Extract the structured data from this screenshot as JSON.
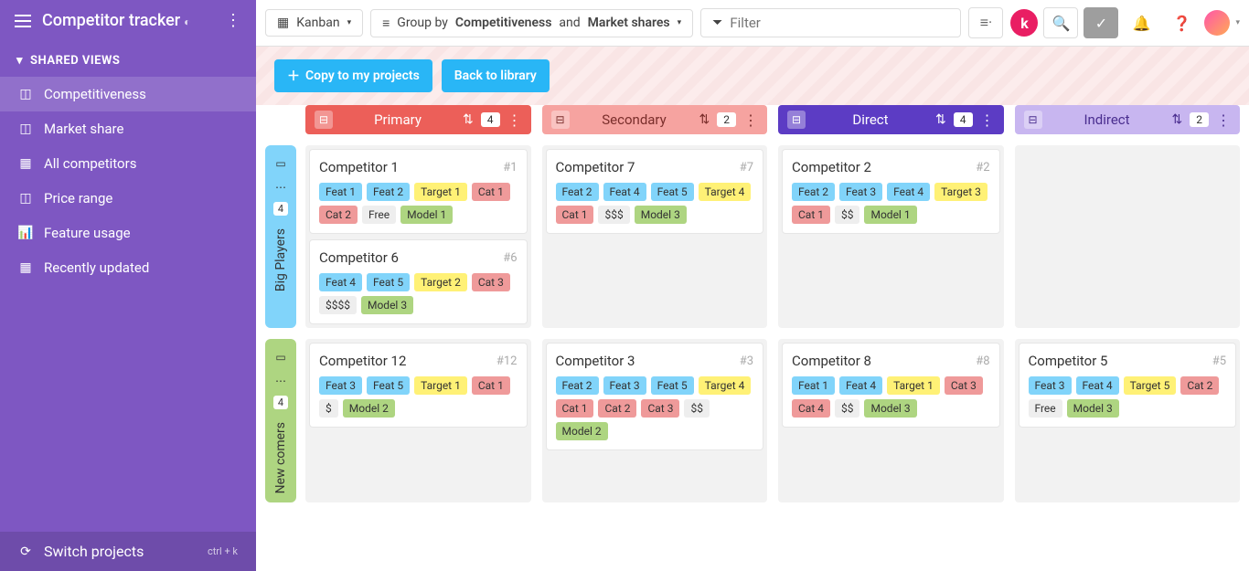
{
  "sidebar": {
    "title": "Competitor tracker",
    "section": "SHARED VIEWS",
    "items": [
      {
        "label": "Competitiveness",
        "icon": "columns"
      },
      {
        "label": "Market share",
        "icon": "columns"
      },
      {
        "label": "All competitors",
        "icon": "grid"
      },
      {
        "label": "Price range",
        "icon": "columns"
      },
      {
        "label": "Feature usage",
        "icon": "chart"
      },
      {
        "label": "Recently updated",
        "icon": "grid"
      }
    ],
    "footer": {
      "label": "Switch projects",
      "hint": "ctrl + k"
    }
  },
  "topbar": {
    "view_label": "Kanban",
    "group_prefix": "Group by ",
    "group_a": "Competitiveness",
    "group_mid": " and ",
    "group_b": "Market shares",
    "filter_placeholder": "Filter",
    "k": "k"
  },
  "banner": {
    "copy": "Copy to my projects",
    "back": "Back to library"
  },
  "columns": [
    {
      "key": "primary",
      "label": "Primary",
      "count": "4"
    },
    {
      "key": "secondary",
      "label": "Secondary",
      "count": "2"
    },
    {
      "key": "direct",
      "label": "Direct",
      "count": "4"
    },
    {
      "key": "indirect",
      "label": "Indirect",
      "count": "2"
    }
  ],
  "swimlanes": [
    {
      "key": "big",
      "label": "Big Players",
      "count": "4",
      "color": "blue"
    },
    {
      "key": "new",
      "label": "New comers",
      "count": "4",
      "color": "green"
    }
  ],
  "cards": {
    "big": {
      "primary": [
        {
          "title": "Competitor 1",
          "num": "#1",
          "tags": [
            [
              "feat",
              "Feat 1"
            ],
            [
              "feat",
              "Feat 2"
            ],
            [
              "target",
              "Target 1"
            ],
            [
              "cat",
              "Cat 1"
            ],
            [
              "cat",
              "Cat 2"
            ],
            [
              "price",
              "Free"
            ],
            [
              "model",
              "Model 1"
            ]
          ]
        },
        {
          "title": "Competitor 6",
          "num": "#6",
          "tags": [
            [
              "feat",
              "Feat 4"
            ],
            [
              "feat",
              "Feat 5"
            ],
            [
              "target",
              "Target 2"
            ],
            [
              "cat",
              "Cat 3"
            ],
            [
              "price",
              "$$$$"
            ],
            [
              "model",
              "Model 3"
            ]
          ]
        }
      ],
      "secondary": [
        {
          "title": "Competitor 7",
          "num": "#7",
          "tags": [
            [
              "feat",
              "Feat 2"
            ],
            [
              "feat",
              "Feat 4"
            ],
            [
              "feat",
              "Feat 5"
            ],
            [
              "target",
              "Target 4"
            ],
            [
              "cat",
              "Cat 1"
            ],
            [
              "price",
              "$$$"
            ],
            [
              "model",
              "Model 3"
            ]
          ]
        }
      ],
      "direct": [
        {
          "title": "Competitor 2",
          "num": "#2",
          "tags": [
            [
              "feat",
              "Feat 2"
            ],
            [
              "feat",
              "Feat 3"
            ],
            [
              "feat",
              "Feat 4"
            ],
            [
              "target",
              "Target 3"
            ],
            [
              "cat",
              "Cat 1"
            ],
            [
              "price",
              "$$"
            ],
            [
              "model",
              "Model 1"
            ]
          ]
        }
      ],
      "indirect": []
    },
    "new": {
      "primary": [
        {
          "title": "Competitor 12",
          "num": "#12",
          "tags": [
            [
              "feat",
              "Feat 3"
            ],
            [
              "feat",
              "Feat 5"
            ],
            [
              "target",
              "Target 1"
            ],
            [
              "cat",
              "Cat 1"
            ],
            [
              "price",
              "$"
            ],
            [
              "model",
              "Model 2"
            ]
          ]
        }
      ],
      "secondary": [
        {
          "title": "Competitor 3",
          "num": "#3",
          "tags": [
            [
              "feat",
              "Feat 2"
            ],
            [
              "feat",
              "Feat 3"
            ],
            [
              "feat",
              "Feat 5"
            ],
            [
              "target",
              "Target 4"
            ],
            [
              "cat",
              "Cat 1"
            ],
            [
              "cat",
              "Cat 2"
            ],
            [
              "cat",
              "Cat 3"
            ],
            [
              "price",
              "$$"
            ],
            [
              "model",
              "Model 2"
            ]
          ]
        }
      ],
      "direct": [
        {
          "title": "Competitor 8",
          "num": "#8",
          "tags": [
            [
              "feat",
              "Feat 1"
            ],
            [
              "feat",
              "Feat 4"
            ],
            [
              "target",
              "Target 1"
            ],
            [
              "cat",
              "Cat 3"
            ],
            [
              "cat",
              "Cat 4"
            ],
            [
              "price",
              "$$"
            ],
            [
              "model",
              "Model 3"
            ]
          ]
        }
      ],
      "indirect": [
        {
          "title": "Competitor 5",
          "num": "#5",
          "tags": [
            [
              "feat",
              "Feat 3"
            ],
            [
              "feat",
              "Feat 4"
            ],
            [
              "target",
              "Target 5"
            ],
            [
              "cat",
              "Cat 2"
            ],
            [
              "price",
              "Free"
            ],
            [
              "model",
              "Model 3"
            ]
          ]
        }
      ]
    }
  }
}
